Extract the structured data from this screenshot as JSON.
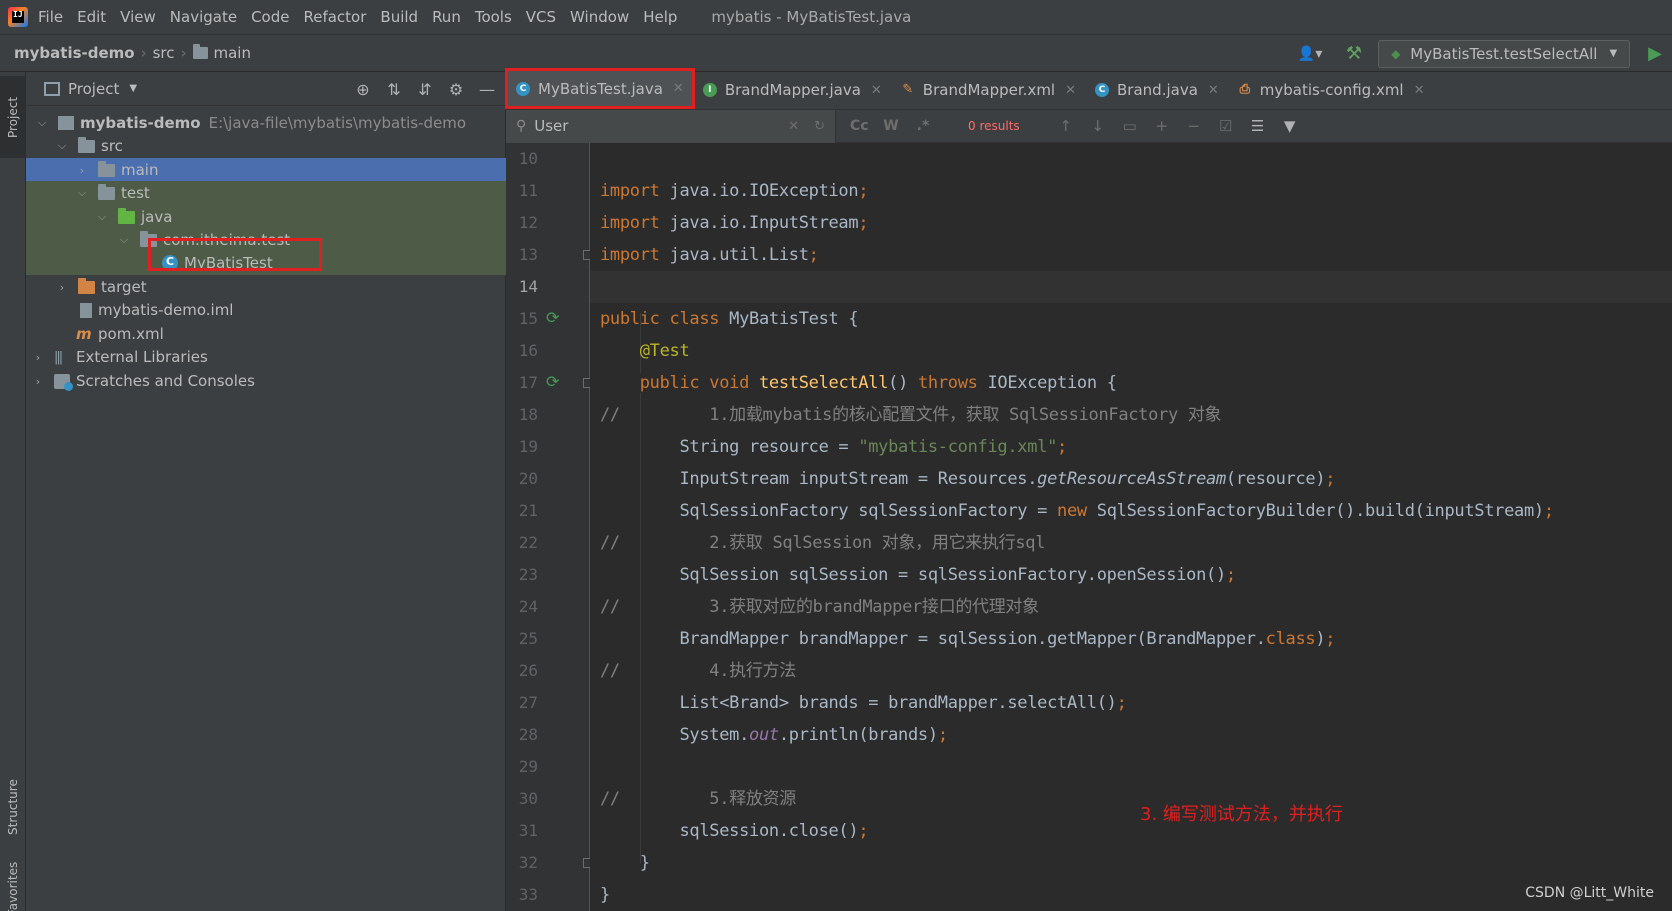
{
  "app": {
    "menu": [
      "File",
      "Edit",
      "View",
      "Navigate",
      "Code",
      "Refactor",
      "Build",
      "Run",
      "Tools",
      "VCS",
      "Window",
      "Help"
    ],
    "window_title": "mybatis - MyBatisTest.java"
  },
  "breadcrumb": [
    "mybatis-demo",
    "src",
    "main"
  ],
  "toolbar": {
    "run_config": "MyBatisTest.testSelectAll"
  },
  "left_strip": {
    "project": "Project",
    "structure": "Structure",
    "favorites": "Favorites"
  },
  "project_panel": {
    "title": "Project",
    "tree": [
      {
        "label": "mybatis-demo",
        "path": "E:\\java-file\\mybatis\\mybatis-demo"
      },
      {
        "label": "src"
      },
      {
        "label": "main"
      },
      {
        "label": "test"
      },
      {
        "label": "java"
      },
      {
        "label": "com.itheima.test"
      },
      {
        "label": "MyBatisTest"
      },
      {
        "label": "target"
      },
      {
        "label": "mybatis-demo.iml"
      },
      {
        "label": "pom.xml"
      },
      {
        "label": "External Libraries"
      },
      {
        "label": "Scratches and Consoles"
      }
    ]
  },
  "tabs": [
    {
      "label": "MyBatisTest.java",
      "icon": "class-icon"
    },
    {
      "label": "BrandMapper.java",
      "icon": "interface-icon"
    },
    {
      "label": "BrandMapper.xml",
      "icon": "xml-icon"
    },
    {
      "label": "Brand.java",
      "icon": "class-icon"
    },
    {
      "label": "mybatis-config.xml",
      "icon": "xml-icon"
    }
  ],
  "search": {
    "query": "User",
    "opt_case": "Cc",
    "opt_words": "W",
    "opt_regex": ".*",
    "results": "0 results"
  },
  "editor": {
    "line_numbers": [
      "10",
      "11",
      "12",
      "13",
      "14",
      "15",
      "16",
      "17",
      "18",
      "19",
      "20",
      "21",
      "22",
      "23",
      "24",
      "25",
      "26",
      "27",
      "28",
      "29",
      "30",
      "31",
      "32",
      "33"
    ],
    "current_line": "14"
  },
  "annotation_note": "3. 编写测试方法，并执行",
  "watermark": "CSDN @Litt_White",
  "colors": {
    "accent": "#4a88c7",
    "highlight_box": "#e02020",
    "selection": "#4b6eaf"
  }
}
